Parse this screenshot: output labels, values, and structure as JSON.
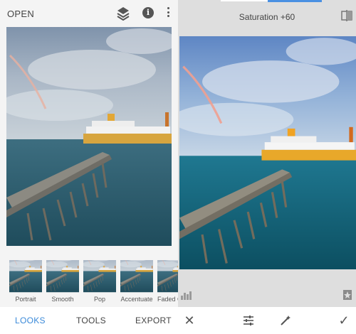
{
  "left_screen": {
    "top_bar": {
      "open_label": "OPEN",
      "icons": [
        "layers-icon",
        "info-icon",
        "more-vert-icon"
      ],
      "info_glyph": "i"
    },
    "looks": [
      {
        "label": "Portrait"
      },
      {
        "label": "Smooth"
      },
      {
        "label": "Pop"
      },
      {
        "label": "Accentuate"
      },
      {
        "label": "Faded Glow"
      }
    ],
    "bottom_tabs": {
      "looks": "LOOKS",
      "tools": "TOOLS",
      "export": "EXPORT",
      "active": "LOOKS"
    }
  },
  "right_screen": {
    "adjustment_label": "Saturation +60",
    "saturation_value": 60,
    "icons": [
      "compare-icon",
      "histogram-icon",
      "style-icon"
    ],
    "bottom_actions": {
      "cancel_glyph": "✕",
      "apply_glyph": "✓",
      "icons": [
        "close-icon",
        "adjust-sliders-icon",
        "auto-wand-icon",
        "check-icon"
      ]
    }
  },
  "colors": {
    "accent": "#3b8ad9",
    "slider_fill": "#4a90e2",
    "toolbar_bg": "#f4f4f4",
    "editor_bg": "#dedede"
  }
}
